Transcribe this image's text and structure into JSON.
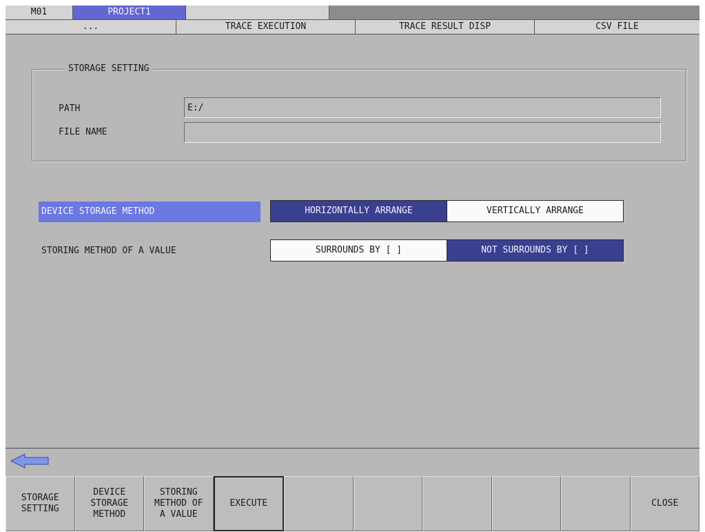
{
  "title_bar": {
    "machine": "M01",
    "project": "PROJECT1",
    "blank": ""
  },
  "menu": {
    "items": [
      "...",
      "TRACE EXECUTION",
      "TRACE RESULT DISP",
      "CSV FILE"
    ]
  },
  "storage_setting": {
    "title": "STORAGE SETTING",
    "path_label": "PATH",
    "path_value": "E:/",
    "file_name_label": "FILE NAME",
    "file_name_value": ""
  },
  "device_storage_method": {
    "label": "DEVICE STORAGE METHOD",
    "selected": "HORIZONTALLY ARRANGE",
    "options": [
      "HORIZONTALLY ARRANGE",
      "VERTICALLY ARRANGE"
    ]
  },
  "storing_method": {
    "label": "STORING METHOD OF A VALUE",
    "selected": "NOT SURROUNDS BY [ ]",
    "options": [
      "SURROUNDS BY [ ]",
      "NOT SURROUNDS BY [ ]"
    ]
  },
  "function_keys": [
    "STORAGE\nSETTING",
    "DEVICE\nSTORAGE\nMETHOD",
    "STORING\nMETHOD OF\nA VALUE",
    "EXECUTE",
    "",
    "",
    "",
    "",
    "",
    "CLOSE"
  ],
  "icons": {
    "back": "left-arrow-icon"
  },
  "colors": {
    "selected_label": "#6a78e0",
    "selected_option": "#3a3f8f",
    "project_tab": "#6266d0",
    "arrow": "#7f96e8"
  }
}
